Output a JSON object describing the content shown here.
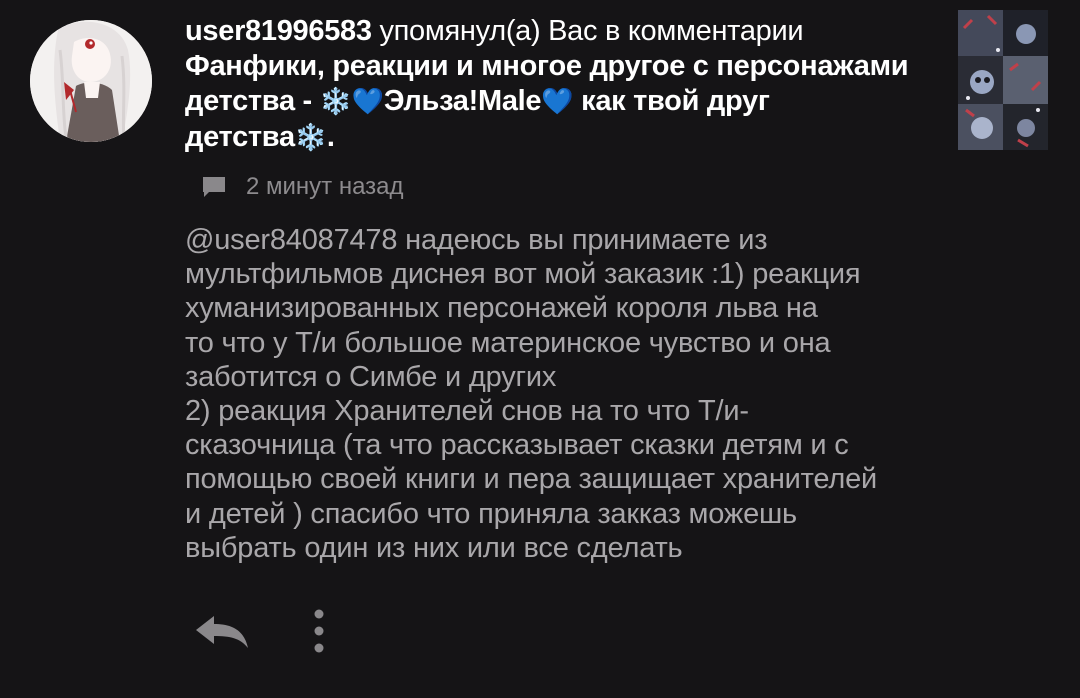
{
  "notification": {
    "username": "user81996583",
    "mention_text": "упомянул(а) Вас в комментарии",
    "title_part1": "Фанфики, реакции и многое другое с персонажами детства - ",
    "title_snow1": "❄️",
    "title_heart1": "💙",
    "title_part2": "Эльза!Male",
    "title_heart2": "💙",
    "title_part3": " как твой друг детства",
    "title_snow2": "❄️",
    "title_end": "."
  },
  "meta": {
    "time_ago": "2 минут назад"
  },
  "comment": {
    "text": "@user84087478 надеюсь вы принимаете из\nмультфильмов диснея вот мой заказик :1) реакция\nхуманизированных персонажей короля льва на\nто что у Т/и большое материнское чувство и она\nзаботится о Симбе и других\n2) реакция Хранителей снов на то что Т/и-\nсказочница (та что рассказывает сказки детям и с\nпомощью своей книги и пера защищает хранителей\nи детей ) спасибо что приняла закказ можешь\nвыбрать один из них или все сделать"
  },
  "icons": {
    "comment": "comment-icon",
    "reply": "reply-icon",
    "more": "more-vertical-icon"
  },
  "colors": {
    "background": "#151416",
    "primary_text": "#ffffff",
    "secondary_text": "#a9a7aa",
    "meta_text": "#8d8b8e",
    "icon": "#8a888b"
  }
}
